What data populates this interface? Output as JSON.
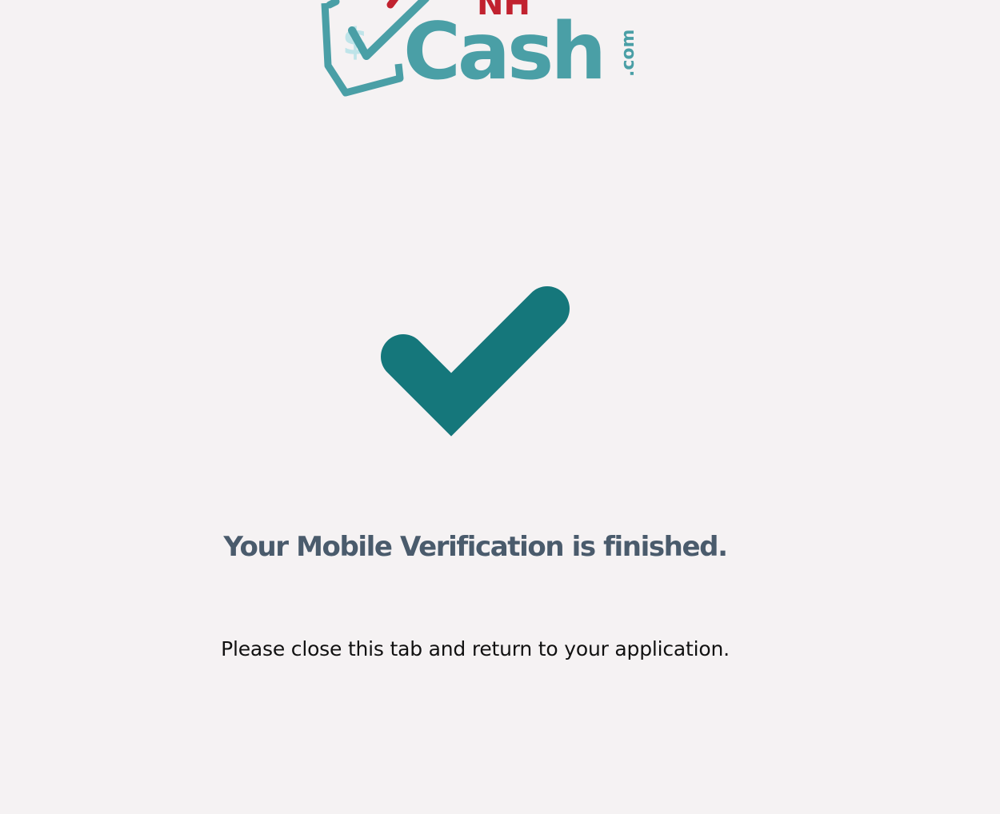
{
  "brand": {
    "logo_icon": "money-check-icon",
    "logo_text_top": "NH",
    "logo_text_main": "Cash",
    "logo_text_suffix": ".com",
    "primary_color": "#4a9fa6",
    "accent_color": "#c1222f"
  },
  "status": {
    "icon": "checkmark-icon",
    "icon_color": "#15777b",
    "heading": "Your Mobile Verification is finished.",
    "message": "Please close this tab and return to your application."
  },
  "colors": {
    "background": "#f5f2f3",
    "heading": "#4a5b6c",
    "message": "#111111"
  }
}
